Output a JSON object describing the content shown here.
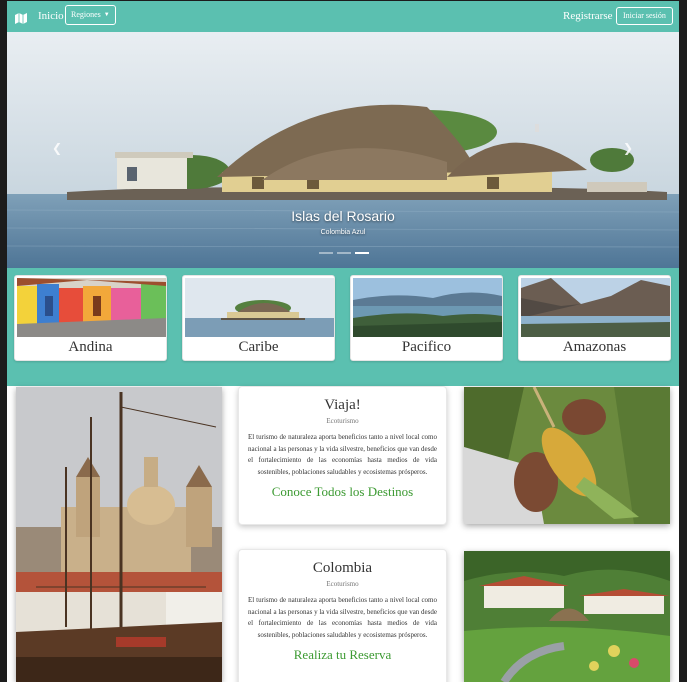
{
  "navbar": {
    "logo_icon": "map-icon",
    "home_label": "Inicio",
    "regions_label": "Regiones",
    "register_label": "Registrarse",
    "login_label": "Iniciar sesión",
    "background": "#5bc0b0"
  },
  "hero": {
    "title": "Islas del Rosario",
    "subtitle": "Colombia Azul",
    "prev_icon": "chevron-left-icon",
    "next_icon": "chevron-right-icon",
    "slides": 3,
    "active_slide": 2
  },
  "regions": [
    {
      "label": "Andina"
    },
    {
      "label": "Caribe"
    },
    {
      "label": "Pacifico"
    },
    {
      "label": "Amazonas"
    }
  ],
  "cards": [
    {
      "title": "Viaja!",
      "subtitle": "Ecoturismo",
      "text": "El turismo de naturaleza aporta beneficios tanto a nivel local como nacional a las personas y la vida silvestre, beneficios que van desde el fortalecimiento de las economías hasta medios de vida sostenibles, poblaciones saludables y ecosistemas prósperos.",
      "link": "Conoce Todos los Destinos"
    },
    {
      "title": "Colombia",
      "subtitle": "Ecoturismo",
      "text": "El turismo de naturaleza aporta beneficios tanto a nivel local como nacional a las personas y la vida silvestre, beneficios que van desde el fortalecimiento de las economías hasta medios de vida sostenibles, poblaciones saludables y ecosistemas prósperos.",
      "link": "Realiza tu Reserva"
    }
  ],
  "colors": {
    "accent": "#5bc0b0",
    "link_green": "#3c9a32"
  }
}
